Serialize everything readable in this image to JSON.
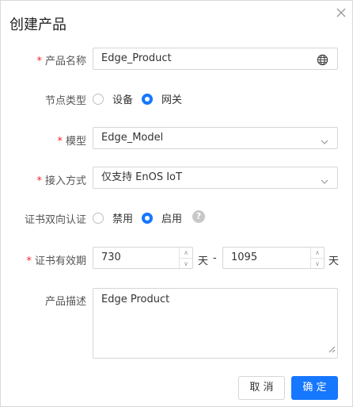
{
  "dialog": {
    "title": "创建产品"
  },
  "product_name": {
    "label": "产品名称",
    "required_mark": "*",
    "value": "Edge_Product"
  },
  "node_type": {
    "label": "节点类型",
    "options": [
      "设备",
      "网关"
    ],
    "selected": "网关"
  },
  "model": {
    "label": "模型",
    "required_mark": "*",
    "value": "Edge_Model"
  },
  "access_method": {
    "label": "接入方式",
    "required_mark": "*",
    "value": "仅支持 EnOS IoT"
  },
  "cert_auth": {
    "label": "证书双向认证",
    "options": [
      "禁用",
      "启用"
    ],
    "selected": "启用",
    "help": "?"
  },
  "cert_validity": {
    "label": "证书有效期",
    "required_mark": "*",
    "from": "730",
    "to": "1095",
    "unit": "天",
    "separator": "-"
  },
  "description": {
    "label": "产品描述",
    "value": "Edge Product"
  },
  "footer": {
    "cancel_label": "取 消",
    "ok_label": "确 定"
  },
  "colors": {
    "accent": "#1677ff",
    "required": "#f5222d"
  }
}
